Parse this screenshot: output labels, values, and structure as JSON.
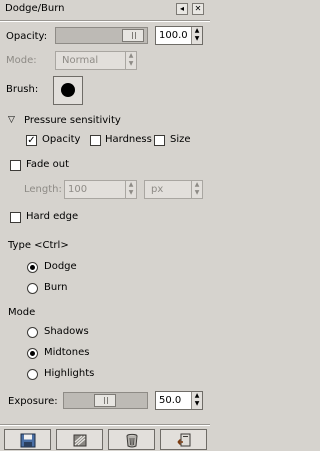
{
  "window": {
    "title": "Dodge/Burn"
  },
  "opacity": {
    "label": "Opacity:",
    "value": "100.0",
    "level_percent": 100
  },
  "mode": {
    "label": "Mode:",
    "value": "Normal"
  },
  "brush": {
    "label": "Brush:"
  },
  "pressure": {
    "header": "Pressure sensitivity",
    "opacity_label": "Opacity",
    "opacity_checked": true,
    "hardness_label": "Hardness",
    "hardness_checked": false,
    "size_label": "Size",
    "size_checked": false
  },
  "fade": {
    "label": "Fade out",
    "checked": false,
    "length_label": "Length:",
    "length_value": "100",
    "unit": "px"
  },
  "hard_edge": {
    "label": "Hard edge",
    "checked": false
  },
  "type": {
    "label": "Type  <Ctrl>",
    "options": [
      "Dodge",
      "Burn"
    ],
    "selected": "Dodge"
  },
  "mode_range": {
    "label": "Mode",
    "options": [
      "Shadows",
      "Midtones",
      "Highlights"
    ],
    "selected": "Midtones"
  },
  "exposure": {
    "label": "Exposure:",
    "value": "50.0",
    "level_percent": 50
  },
  "icons": [
    "save-icon",
    "restore-icon",
    "delete-icon",
    "reset-icon"
  ]
}
